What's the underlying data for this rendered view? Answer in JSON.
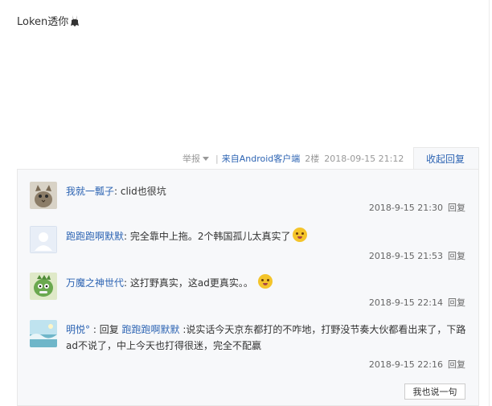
{
  "post": {
    "text": "Loken透你"
  },
  "meta": {
    "report": "举报",
    "sep": "|",
    "client": "来自Android客户端",
    "floor": "2楼",
    "date": "2018-09-15 21:12",
    "collapse": "收起回复"
  },
  "replies": [
    {
      "user": "我就一瓢子",
      "text": ": clid也很坑",
      "time": "2018-9-15 21:30",
      "reply": "回复"
    },
    {
      "user": "跑跑跑啊默默",
      "text": ": 完全靠中上拖。2个韩国孤儿太真实了",
      "time": "2018-9-15 21:53",
      "reply": "回复"
    },
    {
      "user": "万魔之神世代",
      "text": ": 这打野真实，这ad更真实。。",
      "time": "2018-9-15 22:14",
      "reply": "回复"
    },
    {
      "user": "明悦°",
      "prefix": " : 回复 ",
      "target": "跑跑跑啊默默",
      "text": " :说实话今天京东都打的不咋地，打野没节奏大伙都看出来了，下路ad不说了，中上今天也打得很迷，完全不配赢",
      "time": "2018-9-15 22:16",
      "reply": "回复"
    }
  ],
  "reply_box": {
    "label": "我也说一句"
  }
}
